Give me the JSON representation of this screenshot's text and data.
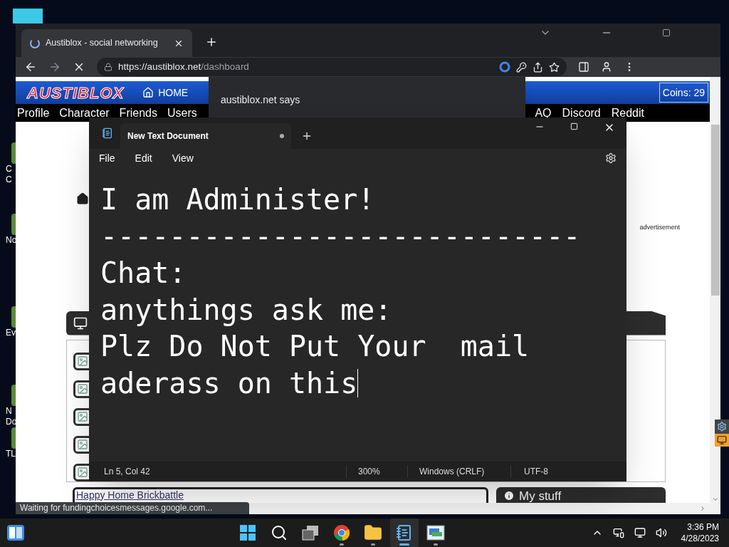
{
  "desktop_icons": [
    {
      "label_lines": [
        "C",
        "C"
      ]
    },
    {
      "label_lines": [
        "No"
      ]
    },
    {
      "label_lines": [
        "Ev"
      ]
    },
    {
      "label_lines": [
        "N",
        "Do"
      ]
    },
    {
      "label_lines": [
        "TL"
      ]
    }
  ],
  "browser": {
    "tab_title": "Austiblox - social networking",
    "loading": true,
    "url_host": "https://austiblox.net",
    "url_path": "/dashboard",
    "status": "Waiting for fundingchoicesmessages.google.com..."
  },
  "site": {
    "logo": "AUSTIBLOX",
    "home": "HOME",
    "coins": "Coins: 29",
    "nav_left": [
      "Profile",
      "Character",
      "Friends",
      "Users"
    ],
    "nav_right": [
      "AQ",
      "Discord",
      "Reddit"
    ],
    "ad": "advertisement",
    "featured_link": "Happy Home Brickbattle",
    "my_stuff": "My stuff"
  },
  "dialog": {
    "title": "austiblox.net says"
  },
  "notepad": {
    "tab": "New Text Document",
    "unsaved": true,
    "menu": [
      "File",
      "Edit",
      "View"
    ],
    "lines": [
      "I am Administer!",
      "----------------------------",
      "Chat:",
      "anythings ask me:",
      "Plz Do Not Put Your  mail",
      "aderass on this"
    ],
    "status": {
      "position": "Ln 5, Col 42",
      "zoom": "300%",
      "line_ending": "Windows (CRLF)",
      "encoding": "UTF-8"
    }
  },
  "taskbar": {
    "apps": [
      {
        "kind": "start",
        "running": false,
        "active": false
      },
      {
        "kind": "search",
        "running": false,
        "active": false
      },
      {
        "kind": "taskview",
        "running": false,
        "active": false
      },
      {
        "kind": "chrome",
        "running": true,
        "active": false
      },
      {
        "kind": "explorer",
        "running": true,
        "active": false
      },
      {
        "kind": "notepad",
        "running": true,
        "active": true
      },
      {
        "kind": "app",
        "running": true,
        "active": false
      }
    ],
    "time": "3:36 PM",
    "date": "4/28/2023"
  }
}
